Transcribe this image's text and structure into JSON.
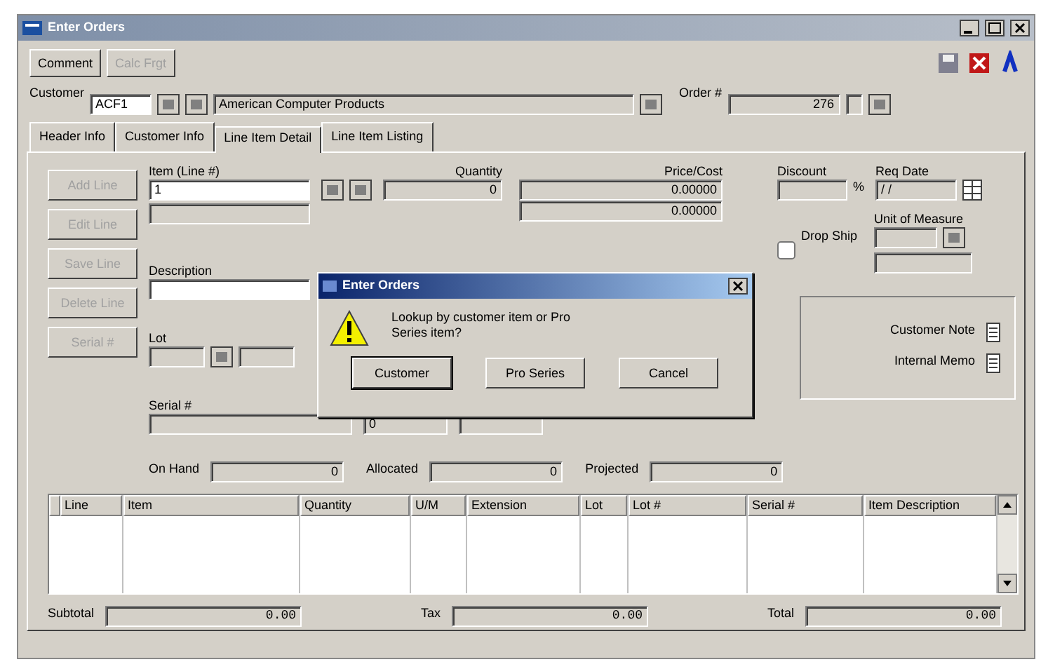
{
  "window": {
    "title": "Enter Orders"
  },
  "toolbar": [
    {
      "label": "Comment",
      "disabled": false
    },
    {
      "label": "Calc Frgt",
      "disabled": true
    }
  ],
  "header": {
    "customer_label": "Customer",
    "customer_id": "ACF1",
    "customer_name": "American Computer Products",
    "order_label": "Order #",
    "order_number": "276"
  },
  "tabs": [
    {
      "label": "Header Info",
      "selected": false
    },
    {
      "label": "Customer Info",
      "selected": false
    },
    {
      "label": "Line Item Detail",
      "selected": true
    },
    {
      "label": "Line Item Listing",
      "selected": false
    }
  ],
  "side_buttons": [
    {
      "label": "Add Line",
      "disabled": true
    },
    {
      "label": "Edit Line",
      "disabled": true
    },
    {
      "label": "Save Line",
      "disabled": true
    },
    {
      "label": "Delete Line",
      "disabled": true
    },
    {
      "label": "Serial #",
      "disabled": true
    }
  ],
  "line_item": {
    "item": {
      "label": "Item (Line #)",
      "value": "1"
    },
    "quantity": {
      "label": "Quantity",
      "value": "0"
    },
    "price_cost": {
      "label": "Price/Cost",
      "values": [
        "0.00000",
        "0.00000"
      ]
    },
    "discount": {
      "label": "Discount",
      "unit": "%"
    },
    "req_date": {
      "label": "Req Date",
      "value": "/ /"
    },
    "unit_of_measure": {
      "label": "Unit of Measure"
    },
    "drop_ship": {
      "label": "Drop Ship",
      "checked": false
    },
    "description": {
      "label": "Description"
    },
    "lot": {
      "label": "Lot"
    },
    "serial": {
      "label": "Serial #",
      "count": "0"
    }
  },
  "notes": [
    {
      "label": "Customer Note"
    },
    {
      "label": "Internal Memo"
    }
  ],
  "stock": [
    {
      "label": "On Hand",
      "value": "0"
    },
    {
      "label": "Allocated",
      "value": "0"
    },
    {
      "label": "Projected",
      "value": "0"
    }
  ],
  "grid": {
    "columns": [
      "Line",
      "Item",
      "Quantity",
      "U/M",
      "Extension",
      "Lot",
      "Lot #",
      "Serial #",
      "Item Description"
    ]
  },
  "totals": [
    {
      "label": "Subtotal",
      "value": "0.00"
    },
    {
      "label": "Tax",
      "value": "0.00"
    },
    {
      "label": "Total",
      "value": "0.00"
    }
  ],
  "dialog": {
    "title": "Enter Orders",
    "message": "Lookup by customer item or Pro Series item?",
    "buttons": [
      {
        "label": "Customer",
        "default": true
      },
      {
        "label": "Pro Series",
        "default": false
      },
      {
        "label": "Cancel",
        "default": false
      }
    ]
  }
}
